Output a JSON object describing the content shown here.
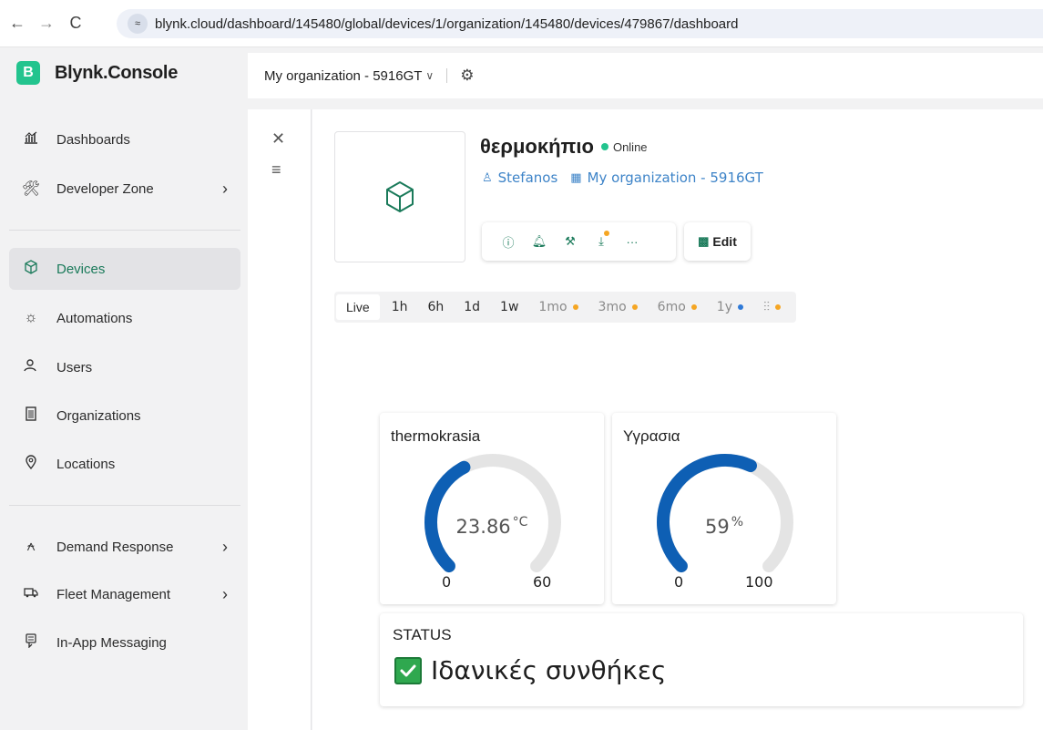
{
  "browser": {
    "url": "blynk.cloud/dashboard/145480/global/devices/1/organization/145480/devices/479867/dashboard",
    "back_icon": "arrow-left-icon",
    "forward_icon": "arrow-right-icon",
    "reload_icon": "reload-icon",
    "site_icon": "tune-icon"
  },
  "app": {
    "logo_letter": "B",
    "logo_text": "Blynk.Console",
    "brand_color": "#23c48e",
    "accent_color": "#1a7a5a"
  },
  "sidebar": {
    "items": [
      {
        "label": "Dashboards",
        "icon": "dashboard-icon"
      },
      {
        "label": "Developer Zone",
        "icon": "tools-icon"
      },
      {
        "label": "Devices",
        "icon": "cube-icon"
      },
      {
        "label": "Automations",
        "icon": "automation-icon"
      },
      {
        "label": "Users",
        "icon": "users-icon"
      },
      {
        "label": "Organizations",
        "icon": "building-icon"
      },
      {
        "label": "Locations",
        "icon": "location-icon"
      },
      {
        "label": "Demand Response",
        "icon": "demand-response-icon"
      },
      {
        "label": "Fleet Management",
        "icon": "truck-icon"
      },
      {
        "label": "In-App Messaging",
        "icon": "messaging-icon"
      }
    ]
  },
  "topbar": {
    "org_name": "My organization - 5916GT"
  },
  "device": {
    "name": "θερμοκήπιο",
    "status": "Online",
    "owner": "Stefanos",
    "organization": "My organization - 5916GT",
    "edit_label": "Edit"
  },
  "timebar": {
    "ranges": [
      "Live",
      "1h",
      "6h",
      "1d",
      "1w",
      "1mo",
      "3mo",
      "6mo",
      "1y"
    ],
    "selected": "Live"
  },
  "widgets": {
    "temperature": {
      "title": "thermokrasia",
      "value": "23.86",
      "unit": "°C",
      "min": "0",
      "max": "60",
      "fraction": 0.3977
    },
    "humidity": {
      "title": "Υγρασια",
      "value": "59",
      "unit": "%",
      "min": "0",
      "max": "100",
      "fraction": 0.59
    },
    "status": {
      "title": "STATUS",
      "text": "Ιδανικές συνθήκες"
    },
    "gauge_color": "#0e5fb4",
    "track_color": "#e4e4e4"
  }
}
